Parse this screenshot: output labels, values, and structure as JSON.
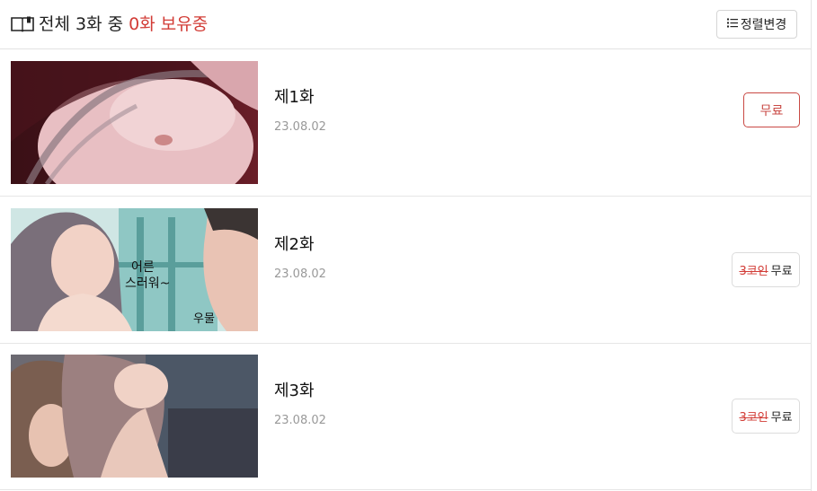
{
  "header": {
    "summary_prefix": "전체 3화 중",
    "summary_owned": "0화 보유중",
    "sort_label": "정렬변경"
  },
  "episodes": [
    {
      "title": "제1화",
      "date": "23.08.02",
      "price_label": "무료"
    },
    {
      "title": "제2화",
      "date": "23.08.02",
      "old_price": "3코인",
      "price_label": "무료",
      "captions": [
        "어른",
        "스러워~",
        "우물"
      ]
    },
    {
      "title": "제3화",
      "date": "23.08.02",
      "old_price": "3코인",
      "price_label": "무료"
    }
  ],
  "colors": {
    "accent": "#d23c36",
    "border": "#e2e2e2",
    "date": "#999999"
  },
  "icons": {
    "header": "book-icon",
    "sort": "list-icon"
  }
}
